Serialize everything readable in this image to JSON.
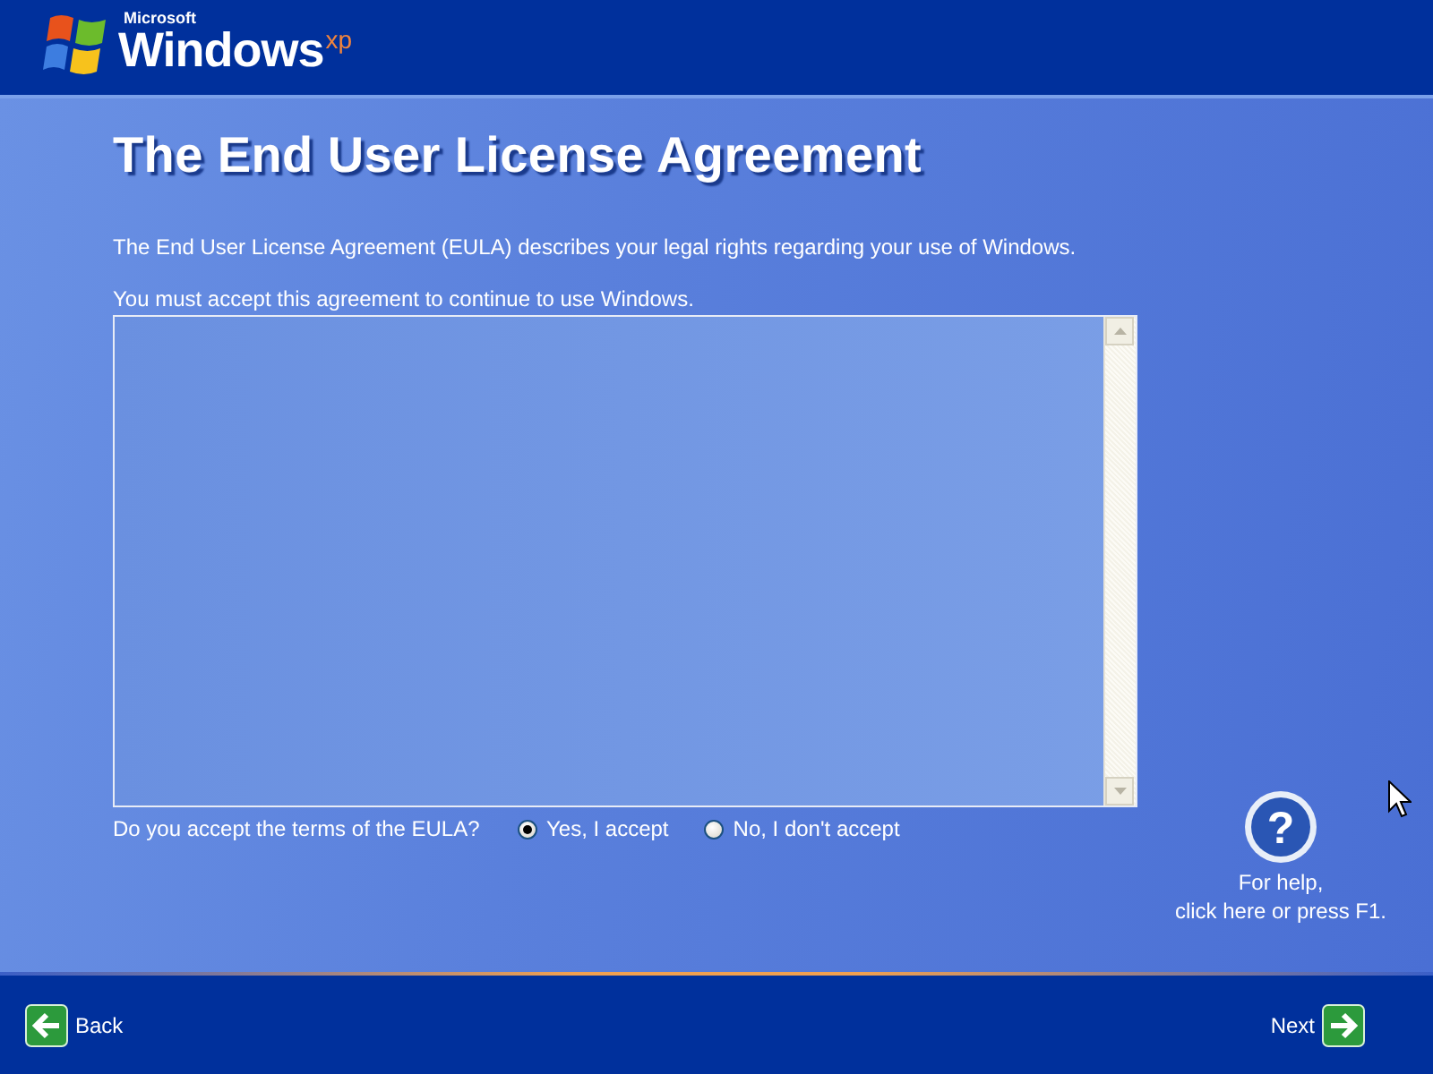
{
  "logo": {
    "maker": "Microsoft",
    "product": "Windows",
    "edition": "xp"
  },
  "title": "The End User License Agreement",
  "description": "The End User License Agreement (EULA) describes your legal rights regarding your use of Windows.",
  "instruction": "You must accept this agreement to continue to use Windows.",
  "question": "Do you accept the terms of the EULA?",
  "options": [
    {
      "label": "Yes, I accept",
      "selected": true
    },
    {
      "label": "No, I don't accept",
      "selected": false
    }
  ],
  "help": {
    "symbol": "?",
    "lines": [
      "For help,",
      "click here or press F1."
    ]
  },
  "buttons": [
    {
      "kind": "back",
      "label": "Back"
    },
    {
      "kind": "next",
      "label": "Next"
    }
  ]
}
